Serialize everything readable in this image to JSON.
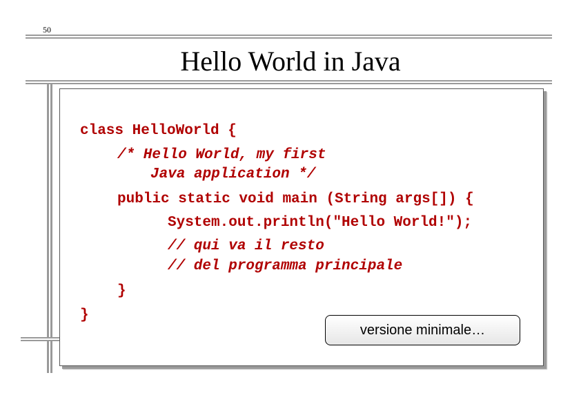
{
  "page_number": "50",
  "title": "Hello World in Java",
  "code": {
    "line1": "class HelloWorld {",
    "line2": "/* Hello World, my first",
    "line3": "Java application */",
    "line4": "public static void main (String args[]) {",
    "line5": "System.out.println(\"Hello World!\");",
    "line6": "// qui va il resto",
    "line7": "// del programma principale",
    "line8": "}",
    "line9": "}"
  },
  "callout": "versione minimale…",
  "colors": {
    "code": "#b00000",
    "rules": "#9a9a9a"
  }
}
